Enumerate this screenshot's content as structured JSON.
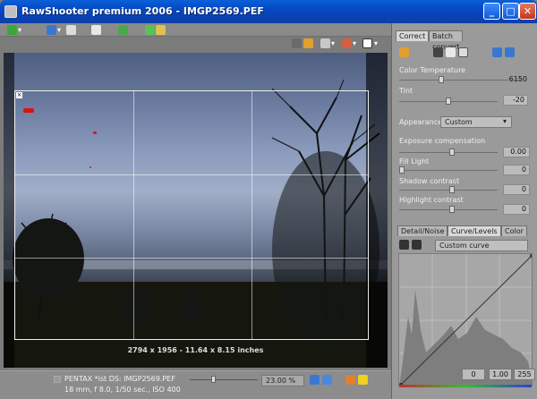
{
  "window": {
    "title": "RawShooter premium 2006 - IMGP2569.PEF",
    "minimize": "_",
    "maximize": "□",
    "close": "✕"
  },
  "colors": {
    "titlebar": "#0546c0",
    "panel": "#9a9a9a",
    "clip_warning": "#e01010"
  },
  "viewer": {
    "crop_info": "2794 x 1956 - 11.64 x 8.15 inches"
  },
  "status": {
    "line1": "PENTAX *ist DS: IMGP2569.PEF",
    "line2": "18 mm, f 8.0, 1/50 sec., ISO 400",
    "zoom": "23.00 %"
  },
  "panel": {
    "tabs": [
      "Correct",
      "Batch convert"
    ],
    "color_temperature": {
      "label": "Color Temperature",
      "value": "6150"
    },
    "tint": {
      "label": "Tint",
      "value": "-20"
    },
    "appearance": {
      "label": "Appearance",
      "value": "Custom"
    },
    "exposure": {
      "label": "Exposure compensation",
      "value": "0.00"
    },
    "fill_light": {
      "label": "Fill Light",
      "value": "0"
    },
    "shadow_contrast": {
      "label": "Shadow contrast",
      "value": "0"
    },
    "highlight_contrast": {
      "label": "Highlight contrast",
      "value": "0"
    },
    "subtabs": [
      "Detail/Noise",
      "Curve/Levels",
      "Color"
    ],
    "curve_preset": "Custom curve",
    "levels": {
      "black": "0",
      "gamma": "1.00",
      "white": "255"
    }
  }
}
